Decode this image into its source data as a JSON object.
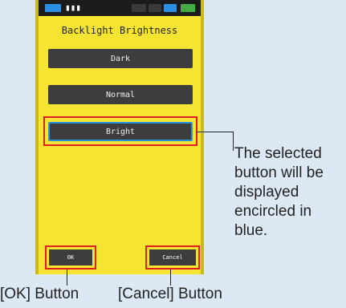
{
  "status_bar": {
    "text": "▮▮▮"
  },
  "screen": {
    "title": "Backlight Brightness",
    "options": [
      "Dark",
      "Normal",
      "Bright"
    ],
    "selected_option": "Bright",
    "ok_label": "OK",
    "cancel_label": "Cancel"
  },
  "annotations": {
    "selected_note": "The selected button will be displayed encircled in blue.",
    "ok_caption": "[OK] Button",
    "cancel_caption": "[Cancel] Button"
  },
  "colors": {
    "screen_bg": "#f5e532",
    "button_bg": "#3d3d3d",
    "selected_ring": "#2a92d8",
    "callout_box": "#e02020"
  }
}
